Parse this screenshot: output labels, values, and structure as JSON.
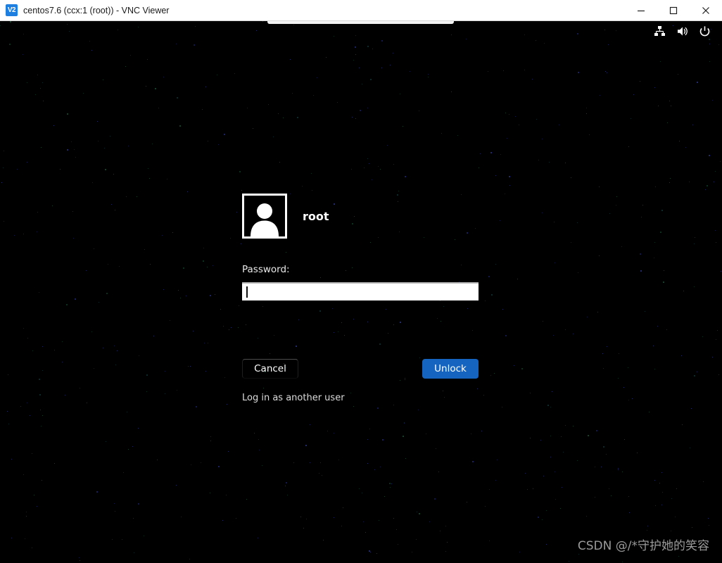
{
  "window": {
    "title": "centos7.6 (ccx:1 (root)) - VNC Viewer",
    "app_icon_label": "V2",
    "controls": {
      "minimize": "minimize-icon",
      "maximize": "maximize-icon",
      "close": "close-icon"
    }
  },
  "desktop": {
    "background_color": "#000000",
    "toolbar_tab": "vnc-toolbar-tab",
    "tray": [
      {
        "name": "network-icon",
        "label": "Network"
      },
      {
        "name": "volume-icon",
        "label": "Volume"
      },
      {
        "name": "power-icon",
        "label": "Power"
      }
    ]
  },
  "unlock_screen": {
    "avatar_icon": "user-avatar-icon",
    "username": "root",
    "password_label": "Password:",
    "password_value": "",
    "password_placeholder": "",
    "cancel_label": "Cancel",
    "unlock_label": "Unlock",
    "other_user_label": "Log in as another user",
    "accent_color": "#1565c0"
  },
  "watermark": {
    "text": "CSDN @/*守护她的笑容"
  }
}
